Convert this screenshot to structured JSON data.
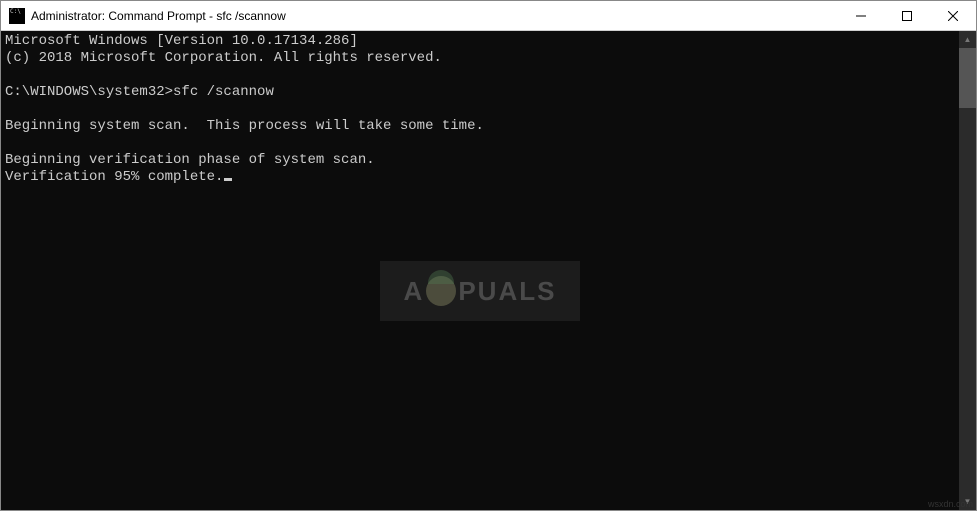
{
  "titlebar": {
    "title": "Administrator: Command Prompt - sfc  /scannow"
  },
  "console": {
    "line1": "Microsoft Windows [Version 10.0.17134.286]",
    "line2": "(c) 2018 Microsoft Corporation. All rights reserved.",
    "blank1": "",
    "prompt_line": "C:\\WINDOWS\\system32>sfc /scannow",
    "blank2": "",
    "line3": "Beginning system scan.  This process will take some time.",
    "blank3": "",
    "line4": "Beginning verification phase of system scan.",
    "line5": "Verification 95% complete."
  },
  "watermark": {
    "left": "A",
    "right": "PUALS"
  },
  "corner": "wsxdn.com"
}
